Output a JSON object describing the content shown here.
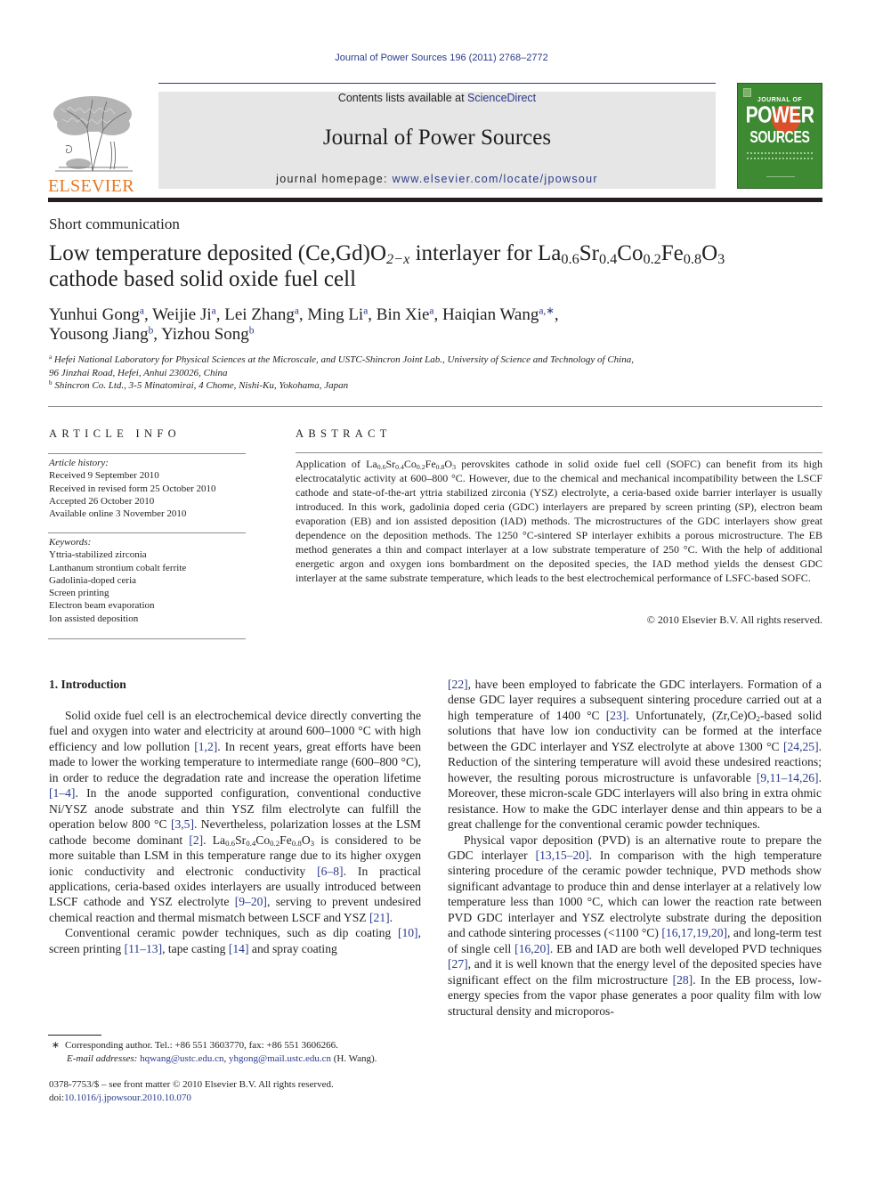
{
  "header": {
    "running_head": "Journal of Power Sources 196 (2011) 2768–2772",
    "contents_prefix": "Contents lists available at ",
    "contents_link": "ScienceDirect",
    "journal_title": "Journal of Power Sources",
    "homepage_prefix": "journal homepage: ",
    "homepage_link": "www.elsevier.com/locate/jpowsour",
    "publisher_logo": "ELSEVIER",
    "cover": {
      "line1": "JOURNAL OF",
      "line2": "POWER",
      "line3": "SOURCES"
    },
    "colors": {
      "link": "#2a3a8c",
      "elsevier_orange": "#e87722",
      "cover_green": "#3d8a33",
      "masthead_gray": "#e6e6e6"
    }
  },
  "article": {
    "type": "Short communication",
    "title": {
      "part1": "Low temperature deposited (Ce,Gd)O",
      "sub1": "2−x",
      "part2": " interlayer for La",
      "sub2": "0.6",
      "part3": "Sr",
      "sub3": "0.4",
      "part4": "Co",
      "sub4": "0.2",
      "part5": "Fe",
      "sub5": "0.8",
      "part6": "O",
      "sub6": "3",
      "line2": "cathode based solid oxide fuel cell"
    },
    "authors": [
      {
        "name": "Yunhui Gong",
        "aff": "a"
      },
      {
        "name": "Weijie Ji",
        "aff": "a"
      },
      {
        "name": "Lei Zhang",
        "aff": "a"
      },
      {
        "name": "Ming Li",
        "aff": "a"
      },
      {
        "name": "Bin Xie",
        "aff": "a"
      },
      {
        "name": "Haiqian Wang",
        "aff": "a,∗"
      },
      {
        "name": "Yousong Jiang",
        "aff": "b"
      },
      {
        "name": "Yizhou Song",
        "aff": "b"
      }
    ],
    "affiliations": [
      {
        "mark": "a",
        "text": "Hefei National Laboratory for Physical Sciences at the Microscale, and USTC-Shincron Joint Lab., University of Science and Technology of China,",
        "text2": "96 Jinzhai Road, Hefei, Anhui 230026, China"
      },
      {
        "mark": "b",
        "text": "Shincron Co. Ltd., 3-5 Minatomirai, 4 Chome, Nishi-Ku, Yokohama, Japan"
      }
    ]
  },
  "article_info": {
    "heading": "ARTICLE INFO",
    "history_label": "Article history:",
    "history": [
      "Received 9 September 2010",
      "Received in revised form 25 October 2010",
      "Accepted 26 October 2010",
      "Available online 3 November 2010"
    ],
    "keywords_label": "Keywords:",
    "keywords": [
      "Yttria-stabilized zirconia",
      "Lanthanum strontium cobalt ferrite",
      "Gadolinia-doped ceria",
      "Screen printing",
      "Electron beam evaporation",
      "Ion assisted deposition"
    ]
  },
  "abstract": {
    "heading": "ABSTRACT",
    "lead": "Application of La",
    "f_sub1": "0.6",
    "f_sr": "Sr",
    "f_sub2": "0.4",
    "f_co": "Co",
    "f_sub3": "0.2",
    "f_fe": "Fe",
    "f_sub4": "0.8",
    "f_o": "O",
    "f_sub5": "3",
    "body": " perovskites cathode in solid oxide fuel cell (SOFC) can benefit from its high electrocatalytic activity at 600–800 °C. However, due to the chemical and mechanical incompatibility between the LSCF cathode and state-of-the-art yttria stabilized zirconia (YSZ) electrolyte, a ceria-based oxide barrier interlayer is usually introduced. In this work, gadolinia doped ceria (GDC) interlayers are prepared by screen printing (SP), electron beam evaporation (EB) and ion assisted deposition (IAD) methods. The microstructures of the GDC interlayers show great dependence on the deposition methods. The 1250 °C-sintered SP interlayer exhibits a porous microstructure. The EB method generates a thin and compact interlayer at a low substrate temperature of 250 °C. With the help of additional energetic argon and oxygen ions bombardment on the deposited species, the IAD method yields the densest GDC interlayer at the same substrate temperature, which leads to the best electrochemical performance of LSFC-based SOFC.",
    "copyright": "© 2010 Elsevier B.V. All rights reserved."
  },
  "body": {
    "section_heading": "1.  Introduction",
    "left": {
      "p1_a": "Solid oxide fuel cell is an electrochemical device directly converting the fuel and oxygen into water and electricity at around 600–1000 °C with high efficiency and low pollution ",
      "ref1": "[1,2]",
      "p1_b": ". In recent years, great efforts have been made to lower the working temperature to intermediate range (600–800 °C), in order to reduce the degradation rate and increase the operation lifetime ",
      "ref2": "[1–4]",
      "p1_c": ". In the anode supported configuration, conventional conductive Ni/YSZ anode substrate and thin YSZ film electrolyte can fulfill the operation below 800 °C ",
      "ref3": "[3,5]",
      "p1_d": ". Nevertheless, polarization losses at the LSM cathode become dominant ",
      "ref4": "[2]",
      "p1_e": ". La",
      "s1": "0.6",
      "sr": "Sr",
      "s2": "0.4",
      "co": "Co",
      "s3": "0.2",
      "fe": "Fe",
      "s4": "0.8",
      "o": "O",
      "s5": "3",
      "p1_f": " is considered to be more suitable than LSM in this temperature range due to its higher oxygen ionic conductivity and electronic conductivity ",
      "ref5": "[6–8]",
      "p1_g": ". In practical applications, ceria-based oxides interlayers are usually introduced between LSCF cathode and YSZ electrolyte ",
      "ref6": "[9–20]",
      "p1_h": ", serving to prevent undesired chemical reaction and thermal mismatch between LSCF and YSZ ",
      "ref7": "[21]",
      "p1_i": ".",
      "p2_a": "Conventional ceramic powder techniques, such as dip coating ",
      "ref8": "[10]",
      "p2_b": ", screen printing ",
      "ref9": "[11–13]",
      "p2_c": ", tape casting ",
      "ref10": "[14]",
      "p2_d": " and spray coating"
    },
    "right": {
      "ref11": "[22]",
      "p1_a": ", have been employed to fabricate the GDC interlayers. Formation of a dense GDC layer requires a subsequent sintering procedure carried out at a high temperature of 1400 °C ",
      "ref12": "[23]",
      "p1_b": ". Unfortunately, (Zr,Ce)O",
      "s1": "2",
      "p1_c": "-based solid solutions that have low ion conductivity can be formed at the interface between the GDC interlayer and YSZ electrolyte at above 1300 °C ",
      "ref13": "[24,25]",
      "p1_d": ". Reduction of the sintering temperature will avoid these undesired reactions; however, the resulting porous microstructure is unfavorable ",
      "ref14": "[9,11–14,26]",
      "p1_e": ". Moreover, these micron-scale GDC interlayers will also bring in extra ohmic resistance. How to make the GDC interlayer dense and thin appears to be a great challenge for the conventional ceramic powder techniques.",
      "p2_a": "Physical vapor deposition (PVD) is an alternative route to prepare the GDC interlayer ",
      "ref15": "[13,15–20]",
      "p2_b": ". In comparison with the high temperature sintering procedure of the ceramic powder technique, PVD methods show significant advantage to produce thin and dense interlayer at a relatively low temperature less than 1000 °C, which can lower the reaction rate between PVD GDC interlayer and YSZ electrolyte substrate during the deposition and cathode sintering processes (<1100 °C) ",
      "ref16": "[16,17,19,20]",
      "p2_c": ", and long-term test of single cell ",
      "ref17": "[16,20]",
      "p2_d": ". EB and IAD are both well developed PVD techniques ",
      "ref18": "[27]",
      "p2_e": ", and it is well known that the energy level of the deposited species have significant effect on the film microstructure ",
      "ref19": "[28]",
      "p2_f": ". In the EB process, low-energy species from the vapor phase generates a poor quality film with low structural density and microporos-"
    }
  },
  "footnote": {
    "mark": "∗",
    "corresponding": "Corresponding author. Tel.: +86 551 3603770, fax: +86 551 3606266.",
    "email_label": "E-mail addresses:",
    "email1": "hqwang@ustc.edu.cn",
    "email2": "yhgong@mail.ustc.edu.cn",
    "email_suffix": " (H. Wang)."
  },
  "front_matter": {
    "issn_line": "0378-7753/$ – see front matter © 2010 Elsevier B.V. All rights reserved.",
    "doi_prefix": "doi:",
    "doi": "10.1016/j.jpowsour.2010.10.070"
  }
}
